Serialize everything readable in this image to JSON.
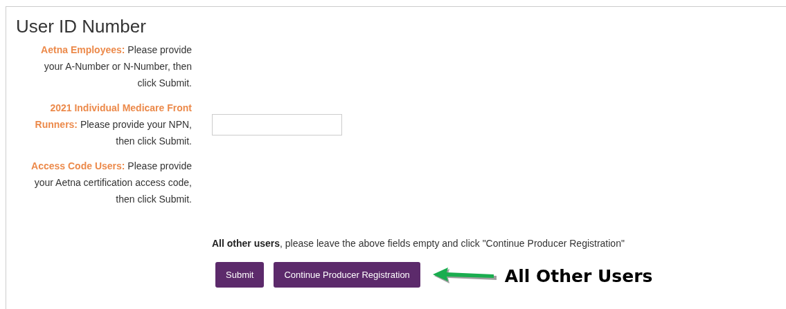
{
  "section": {
    "title": "User ID Number"
  },
  "instructions": [
    "**Aetna Employees:** Please provide your A-Number or N-Number, then click Submit.",
    "**2021 Individual Medicare Front Runners:** Please provide your NPN, then click Submit.",
    "**Access Code Users:** Please provide your Aetna certification access code, then click Submit."
  ],
  "note": "**All other users**, please leave the above fields empty and click \"Continue Producer Registration\"",
  "buttons": [
    "Submit",
    "Continue Producer Registration"
  ],
  "annotation": {
    "label": "All Other Users"
  }
}
